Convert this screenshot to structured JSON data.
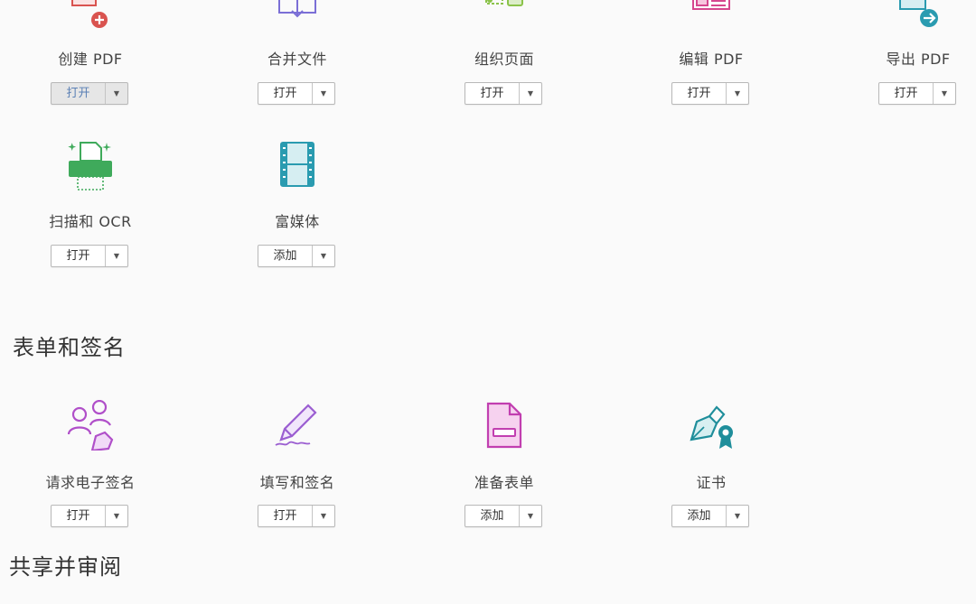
{
  "top_tools": [
    {
      "label": "创建 PDF",
      "button": "打开",
      "icon": "create-pdf-icon"
    },
    {
      "label": "合并文件",
      "button": "打开",
      "icon": "combine-files-icon"
    },
    {
      "label": "组织页面",
      "button": "打开",
      "icon": "organize-pages-icon"
    },
    {
      "label": "编辑 PDF",
      "button": "打开",
      "icon": "edit-pdf-icon"
    },
    {
      "label": "导出 PDF",
      "button": "打开",
      "icon": "export-pdf-icon"
    },
    {
      "label": "扫描和 OCR",
      "button": "打开",
      "icon": "scan-ocr-icon"
    },
    {
      "label": "富媒体",
      "button": "添加",
      "icon": "rich-media-icon"
    }
  ],
  "forms_section": {
    "title": "表单和签名",
    "tools": [
      {
        "label": "请求电子签名",
        "button": "打开",
        "icon": "request-esign-icon"
      },
      {
        "label": "填写和签名",
        "button": "打开",
        "icon": "fill-sign-icon"
      },
      {
        "label": "准备表单",
        "button": "添加",
        "icon": "prepare-form-icon"
      },
      {
        "label": "证书",
        "button": "添加",
        "icon": "certificates-icon"
      }
    ]
  },
  "share_section": {
    "title": "共享并审阅"
  },
  "dropdown_glyph": "▼",
  "colors": {
    "create_red": "#d9534f",
    "combine_purple": "#7b6fd6",
    "organize_green": "#8bc34a",
    "edit_pink": "#d6478f",
    "export_teal": "#2a9bb0",
    "scan_green": "#3faa5b",
    "media_teal": "#2a9bb0",
    "forms_purple": "#b04fc9",
    "certificate_teal": "#1f8e9b"
  }
}
